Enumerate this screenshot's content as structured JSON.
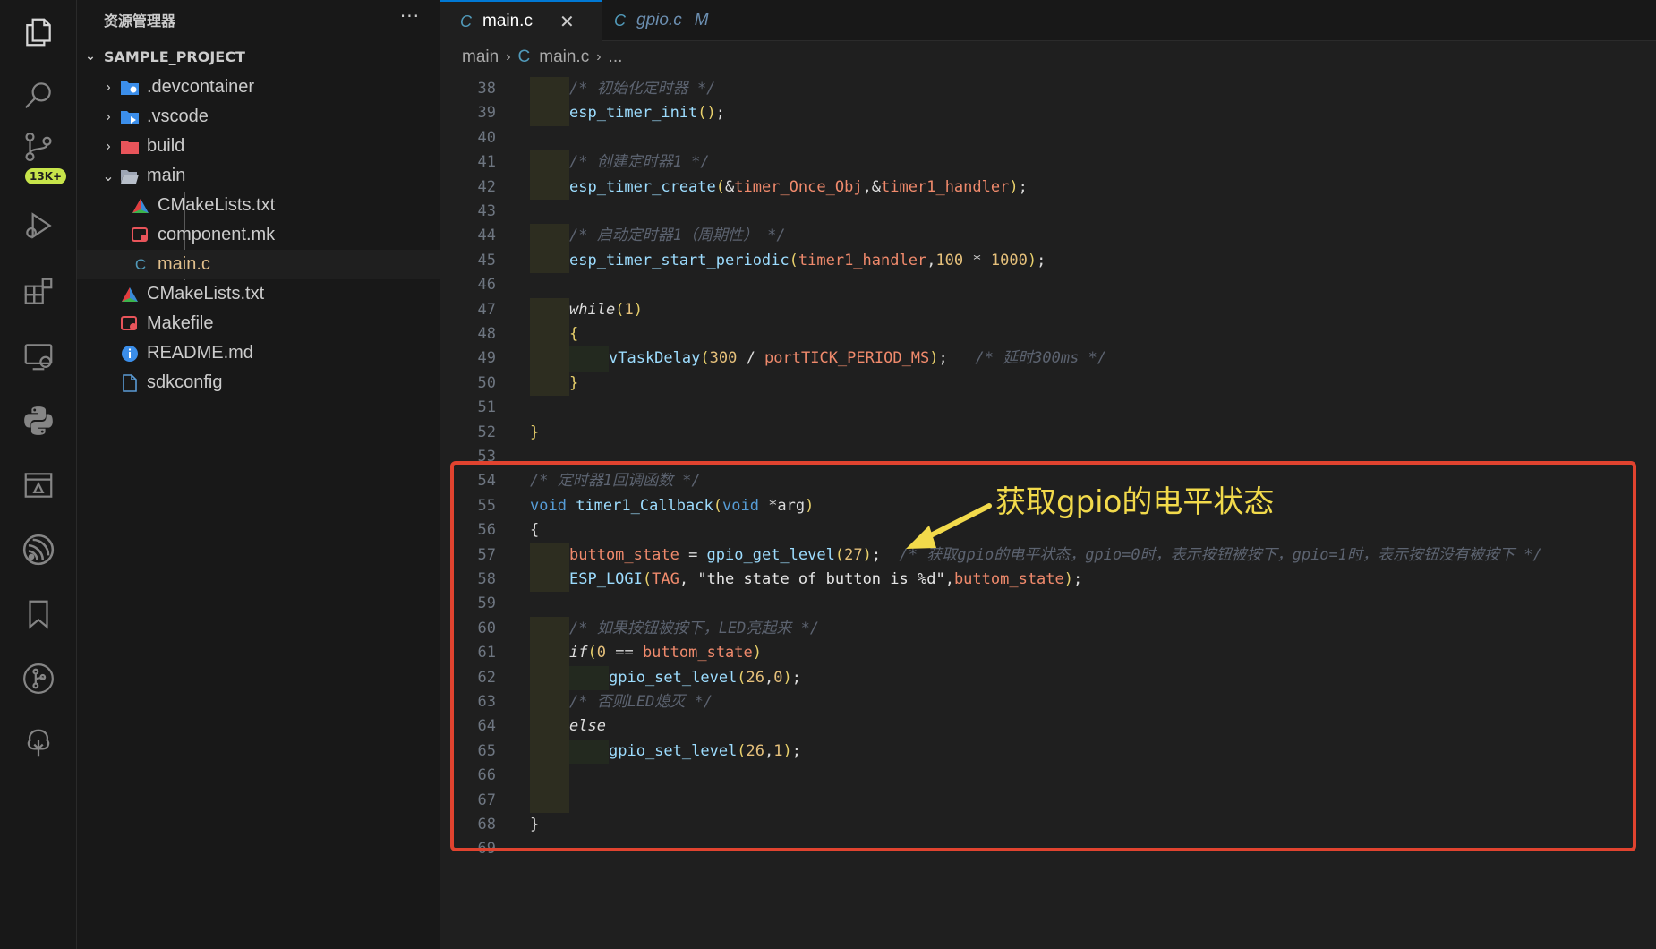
{
  "activity": {
    "badge": "13K+",
    "icons": [
      "explorer-icon",
      "search-icon",
      "source-control-icon",
      "run-debug-icon",
      "extensions-icon",
      "remote-explorer-icon",
      "python-icon",
      "testing-icon",
      "espressif-icon",
      "bookmark-icon",
      "git-graph-icon",
      "tree-icon"
    ]
  },
  "sidebar": {
    "title": "资源管理器",
    "more": "···",
    "project": "SAMPLE_PROJECT",
    "items": [
      {
        "label": ".devcontainer",
        "type": "folder-closed"
      },
      {
        "label": ".vscode",
        "type": "folder-closed"
      },
      {
        "label": "build",
        "type": "folder-closed"
      },
      {
        "label": "main",
        "type": "folder-open"
      },
      {
        "label": "CMakeLists.txt",
        "type": "cmake"
      },
      {
        "label": "component.mk",
        "type": "make"
      },
      {
        "label": "main.c",
        "type": "c"
      },
      {
        "label": "CMakeLists.txt",
        "type": "cmake"
      },
      {
        "label": "Makefile",
        "type": "make"
      },
      {
        "label": "README.md",
        "type": "info"
      },
      {
        "label": "sdkconfig",
        "type": "file"
      }
    ]
  },
  "tabs": [
    {
      "label": "main.c",
      "icon": "C",
      "close": "✕"
    },
    {
      "label": "gpio.c",
      "icon": "C",
      "modified": "M"
    }
  ],
  "breadcrumb": {
    "folder": "main",
    "icon": "C",
    "file": "main.c",
    "rest": "..."
  },
  "line_numbers": [
    "38",
    "39",
    "40",
    "41",
    "42",
    "43",
    "44",
    "45",
    "46",
    "47",
    "48",
    "49",
    "50",
    "51",
    "52",
    "53",
    "54",
    "55",
    "56",
    "57",
    "58",
    "59",
    "60",
    "61",
    "62",
    "63",
    "64",
    "65",
    "66",
    "67",
    "68",
    "69"
  ],
  "code": {
    "l38": "/* 初始化定时器 */",
    "l39_fn": "esp_timer_init",
    "l41": "/* 创建定时器1 */",
    "l42_fn": "esp_timer_create",
    "l42_a1": "timer_Once_Obj",
    "l42_a2": "timer1_handler",
    "l44": "/* 启动定时器1（周期性） */",
    "l45_fn": "esp_timer_start_periodic",
    "l45_a1": "timer1_handler",
    "l45_n1": "100",
    "l45_n2": "1000",
    "l47_kw": "while",
    "l47_n": "1",
    "l49_fn": "vTaskDelay",
    "l49_n": "300",
    "l49_v": "portTICK_PERIOD_MS",
    "l49_c": "/* 延时300ms */",
    "l54": "/* 定时器1回调函数 */",
    "l55_t": "void",
    "l55_fn": "timer1_Callback",
    "l55_t2": "void",
    "l55_arg": "*arg",
    "l57_v": "buttom_state",
    "l57_fn": "gpio_get_level",
    "l57_n": "27",
    "l57_c": "/* 获取gpio的电平状态，gpio=0时，表示按钮被按下，gpio=1时，表示按钮没有被按下 */",
    "l58_fn": "ESP_LOGI",
    "l58_v": "TAG",
    "l58_s": "\"the state of button is %d\"",
    "l58_v2": "buttom_state",
    "l60": "/* 如果按钮被按下，LED亮起来 */",
    "l61_kw": "if",
    "l61_n": "0",
    "l61_v": "buttom_state",
    "l62_fn": "gpio_set_level",
    "l62_n1": "26",
    "l62_n2": "0",
    "l63": "/* 否则LED熄灭 */",
    "l64_kw": "else",
    "l65_fn": "gpio_set_level",
    "l65_n1": "26",
    "l65_n2": "1"
  },
  "annotation": {
    "text": "获取gpio的电平状态",
    "box_color": "#e0432f",
    "arrow_color": "#f2da4b"
  }
}
